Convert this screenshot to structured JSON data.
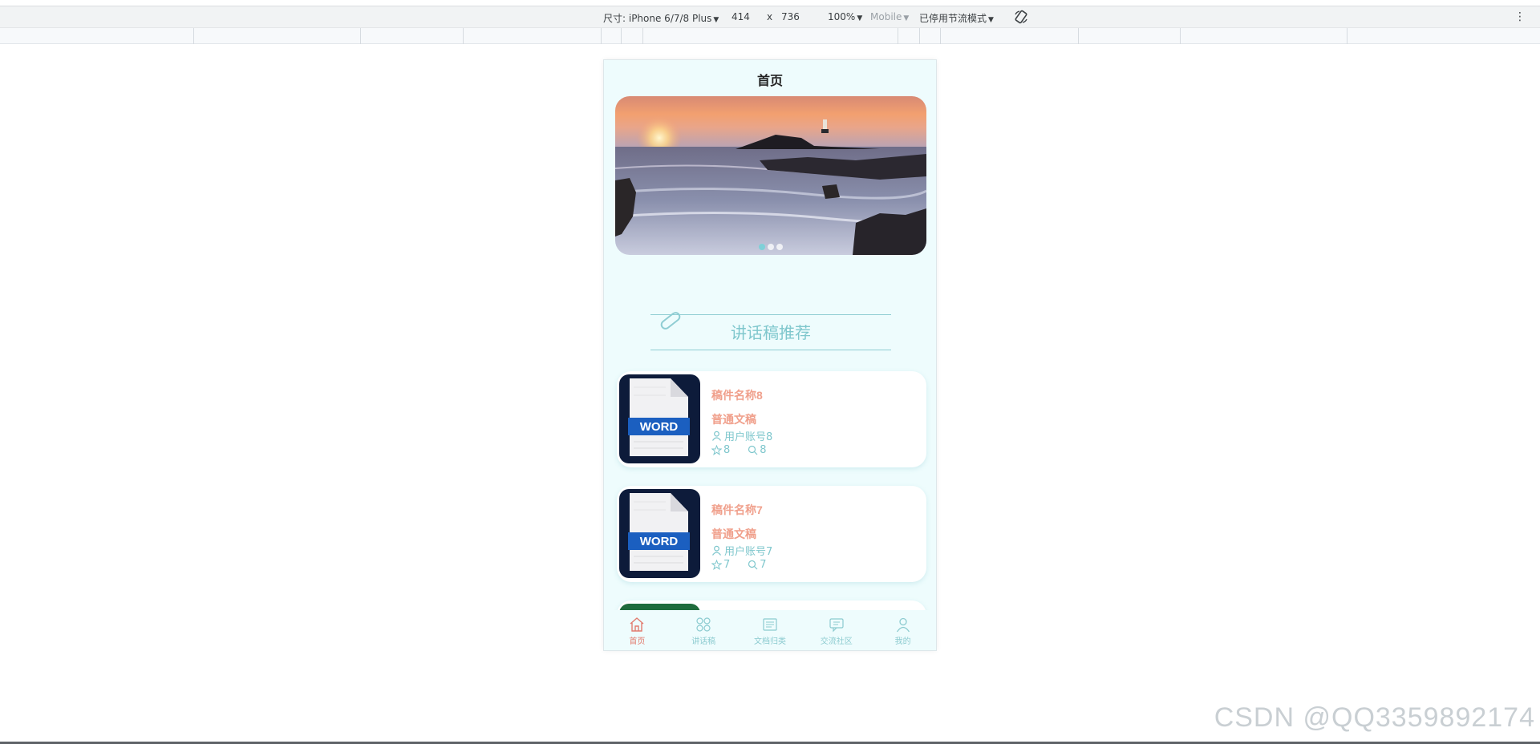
{
  "devtools": {
    "device_label": "尺寸: iPhone 6/7/8 Plus",
    "width": "414",
    "times": "x",
    "height": "736",
    "zoom": "100%",
    "mode": "Mobile",
    "throttle": "已停用节流模式",
    "more_menu": "⋮"
  },
  "page": {
    "title": "首页",
    "banner": {
      "dot_count": 3,
      "active_dot": 0
    },
    "section_title": "讲话稿推荐",
    "cards": [
      {
        "name": "稿件名称8",
        "category": "普通文稿",
        "user": "用户账号8",
        "stars": "8",
        "views": "8",
        "thumb_label": "WORD"
      },
      {
        "name": "稿件名称7",
        "category": "普通文稿",
        "user": "用户账号7",
        "stars": "7",
        "views": "7",
        "thumb_label": "WORD"
      }
    ]
  },
  "tabbar": {
    "items": [
      {
        "label": "首页",
        "icon": "home-icon",
        "active": true
      },
      {
        "label": "讲话稿",
        "icon": "grid-icon",
        "active": false
      },
      {
        "label": "文档归类",
        "icon": "folder-icon",
        "active": false
      },
      {
        "label": "交流社区",
        "icon": "chat-icon",
        "active": false
      },
      {
        "label": "我的",
        "icon": "user-icon",
        "active": false
      }
    ]
  },
  "watermark": "CSDN @QQ3359892174",
  "colors": {
    "accent_teal": "#7fc7cd",
    "accent_salmon": "#f0a08c",
    "page_bg": "#eefcfd",
    "tab_active": "#e27b6e"
  }
}
